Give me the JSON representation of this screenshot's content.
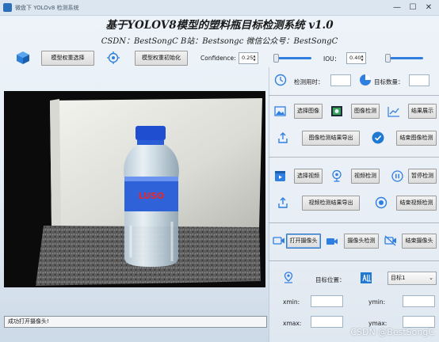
{
  "window": {
    "title": "微盘下 YOLOv8 检测系统"
  },
  "header": {
    "title": "基于YOLOV8模型的塑料瓶目标检测系统 v1.0",
    "subtitle": "CSDN：BestSongC   B站：Bestsongc   微信公众号：BestSongC"
  },
  "toolbar": {
    "model_select_label": "模型权重选择",
    "model_init_label": "模型权重初始化",
    "confidence_label": "Confidence:",
    "confidence_value": "0.25",
    "iou_label": "IOU：",
    "iou_value": "0.40",
    "confidence_level": 0.25,
    "iou_level": 0.4
  },
  "stats": {
    "time_label": "检测用时：",
    "time_value": "",
    "count_label": "目标数量：",
    "count_value": ""
  },
  "image_section": {
    "select_label": "选择图像",
    "detect_label": "图像检测",
    "show_label": "结果展示",
    "export_label": "图像检测结果导出",
    "end_label": "结束图像检测"
  },
  "video_section": {
    "select_label": "选择视频",
    "detect_label": "视频检测",
    "pause_label": "暂停检测",
    "export_label": "视频检测结果导出",
    "end_label": "结束视频检测"
  },
  "camera_section": {
    "open_label": "打开摄像头",
    "detect_label": "摄像头检测",
    "end_label": "结束摄像头"
  },
  "target": {
    "position_label": "目标位置：",
    "selected": "目标1",
    "xmin_label": "xmin:",
    "xmin_value": "",
    "ymin_label": "ymin:",
    "ymin_value": "",
    "xmax_label": "xmax:",
    "xmax_value": "",
    "ymax_label": "ymax:",
    "ymax_value": ""
  },
  "bottle": {
    "brand": "LUSO"
  },
  "status": {
    "message": "成功打开摄像头!"
  },
  "watermark": "CSDN @BestSongC",
  "colors": {
    "accent": "#2f7fe0",
    "title_bar": "#dbe6f1",
    "video_bg": "#0b0b0b"
  }
}
